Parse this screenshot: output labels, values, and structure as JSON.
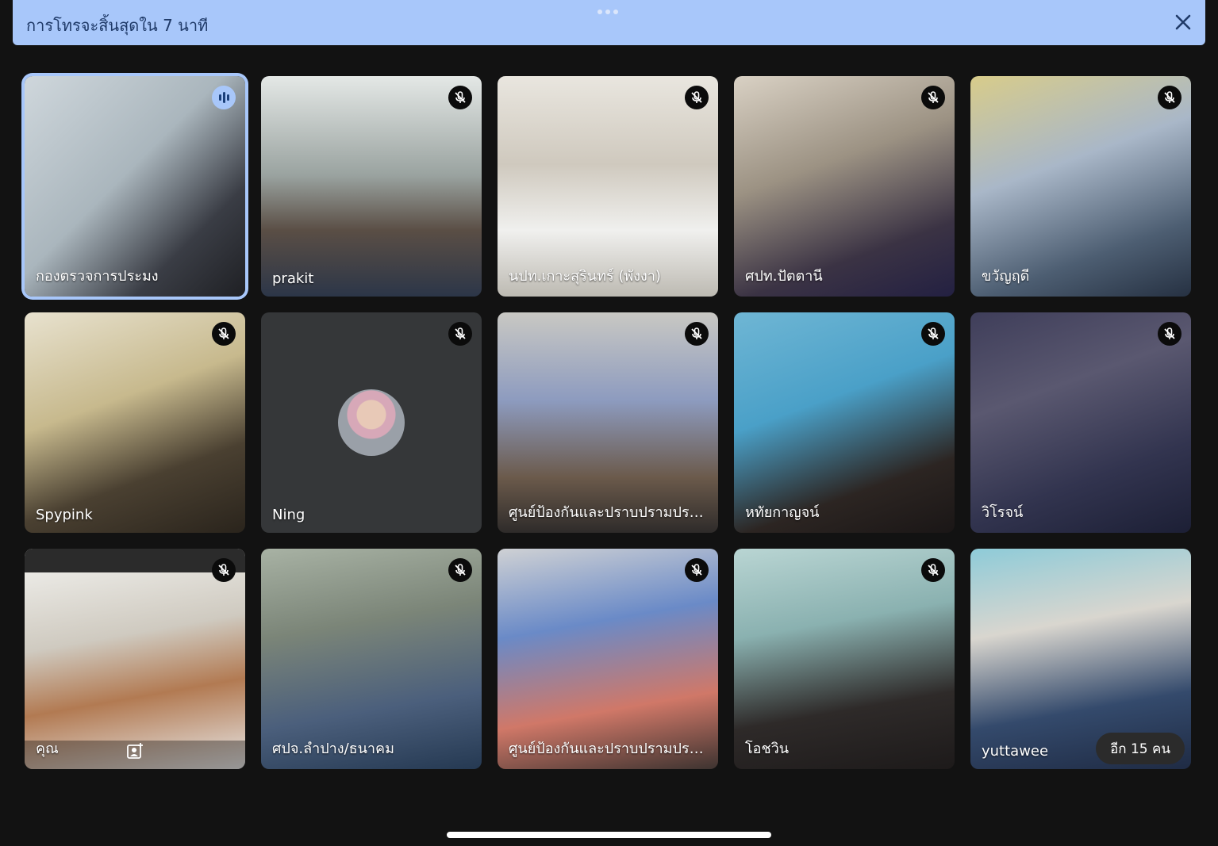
{
  "banner": {
    "text": "การโทรจะสิ้นสุดใน 7 นาที",
    "close_icon": "close-icon"
  },
  "tiles": [
    {
      "name": "กองตรวจการประมง",
      "mic": "speaking"
    },
    {
      "name": "prakit",
      "mic": "muted"
    },
    {
      "name": "นปท.เกาะสุรินทร์ (พังงา)",
      "mic": "muted"
    },
    {
      "name": "ศปท.ปัตตานี",
      "mic": "muted"
    },
    {
      "name": "ขวัญฤดี",
      "mic": "muted"
    },
    {
      "name": "Spypink",
      "mic": "muted"
    },
    {
      "name": "Ning",
      "mic": "muted"
    },
    {
      "name": "ศูนย์ป้องกันและปราบปรามประ...",
      "mic": "muted"
    },
    {
      "name": "หทัยกาญจน์",
      "mic": "muted"
    },
    {
      "name": "วิโรจน์",
      "mic": "muted"
    },
    {
      "name": "คุณ",
      "mic": "muted"
    },
    {
      "name": "ศปจ.ลำปาง/ธนาคม",
      "mic": "muted"
    },
    {
      "name": "ศูนย์ป้องกันและปราบปรามประ...",
      "mic": "muted"
    },
    {
      "name": "โอชวิน",
      "mic": "muted"
    },
    {
      "name": "yuttawee",
      "mic": "none"
    }
  ],
  "more_participants": "อีก 15 คน"
}
